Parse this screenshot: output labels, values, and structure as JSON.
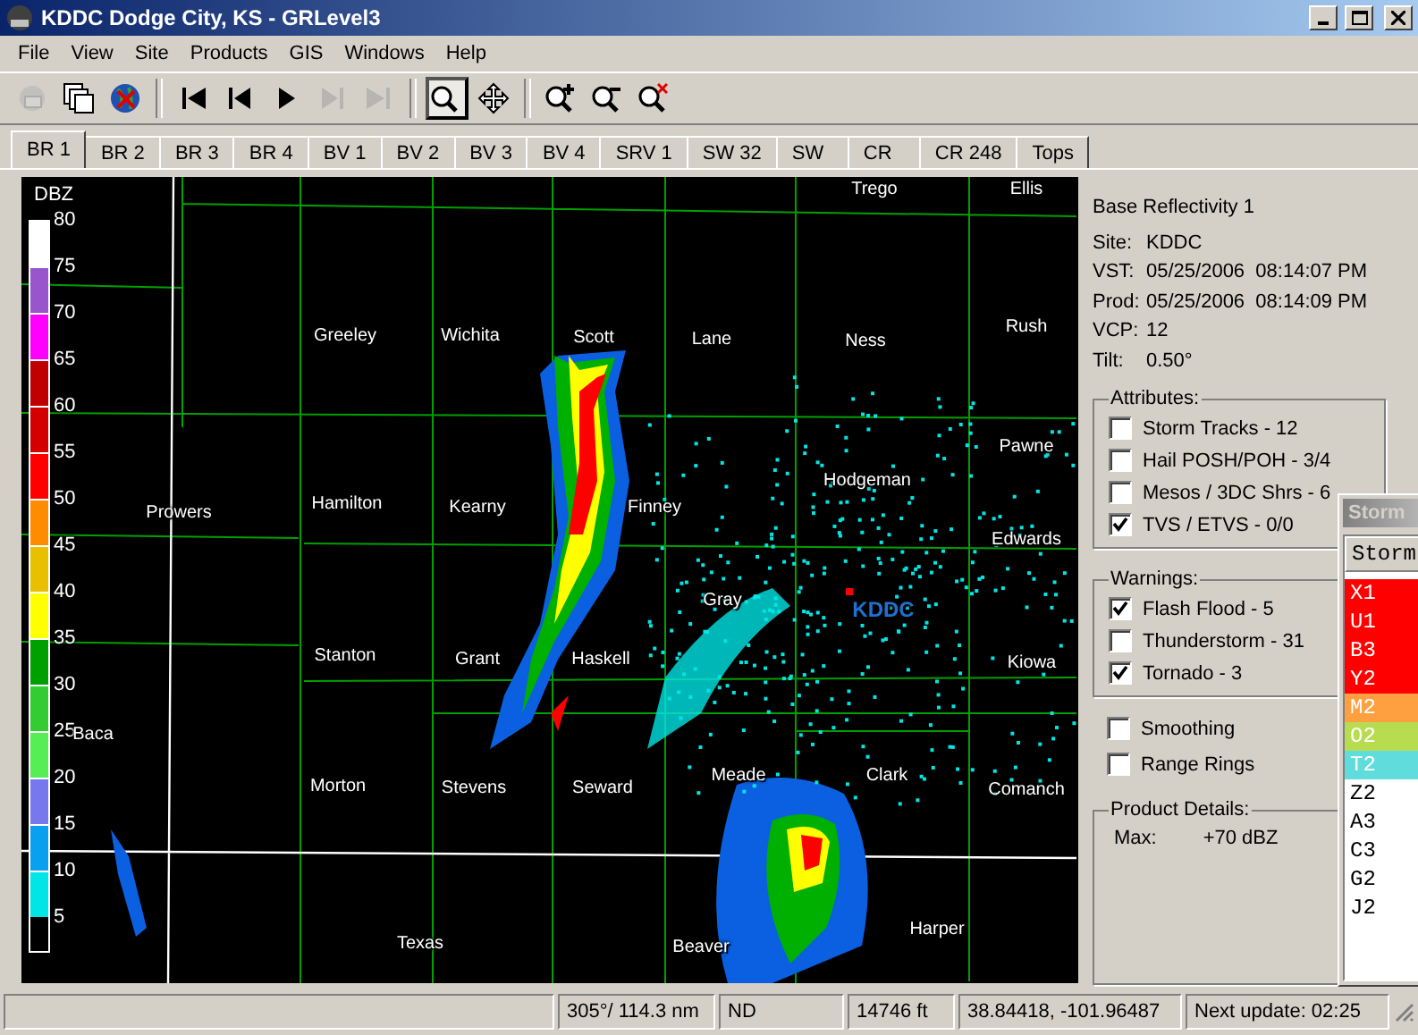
{
  "window": {
    "title": "KDDC Dodge City, KS - GRLevel3"
  },
  "menu": [
    "File",
    "View",
    "Site",
    "Products",
    "GIS",
    "Windows",
    "Help"
  ],
  "toolbar": [
    {
      "kind": "save",
      "disabled": true,
      "selected": false
    },
    {
      "kind": "copy",
      "disabled": false,
      "selected": false
    },
    {
      "kind": "globe",
      "disabled": false,
      "selected": false
    },
    {
      "kind": "separator"
    },
    {
      "kind": "first",
      "disabled": false,
      "selected": false
    },
    {
      "kind": "prev",
      "disabled": false,
      "selected": false
    },
    {
      "kind": "play",
      "disabled": false,
      "selected": false
    },
    {
      "kind": "next",
      "disabled": true,
      "selected": false
    },
    {
      "kind": "last",
      "disabled": true,
      "selected": false
    },
    {
      "kind": "separator"
    },
    {
      "kind": "zoom",
      "disabled": false,
      "selected": true
    },
    {
      "kind": "pan",
      "disabled": false,
      "selected": false
    },
    {
      "kind": "separator"
    },
    {
      "kind": "zoom-in",
      "disabled": false,
      "selected": false
    },
    {
      "kind": "zoom-out",
      "disabled": false,
      "selected": false
    },
    {
      "kind": "zoom-reset",
      "disabled": false,
      "selected": false
    }
  ],
  "tabs": [
    {
      "label": "BR 1",
      "selected": true
    },
    {
      "label": "BR 2",
      "selected": false
    },
    {
      "label": "BR 3",
      "selected": false
    },
    {
      "label": "BR 4",
      "selected": false
    },
    {
      "label": "BV 1",
      "selected": false
    },
    {
      "label": "BV 2",
      "selected": false
    },
    {
      "label": "BV 3",
      "selected": false
    },
    {
      "label": "BV 4",
      "selected": false
    },
    {
      "label": "SRV 1",
      "selected": false
    },
    {
      "label": "SW 32",
      "selected": false
    },
    {
      "label": "SW",
      "selected": false
    },
    {
      "label": "CR",
      "selected": false
    },
    {
      "label": "CR 248",
      "selected": false
    },
    {
      "label": "Tops",
      "selected": false
    }
  ],
  "legend": {
    "title": "DBZ",
    "ticks": [
      "80",
      "75",
      "70",
      "65",
      "60",
      "55",
      "50",
      "45",
      "40",
      "35",
      "30",
      "25",
      "20",
      "15",
      "10",
      "5"
    ],
    "bands": [
      {
        "color": "#ffffff"
      },
      {
        "color": "#9955cc"
      },
      {
        "color": "#ff00ff"
      },
      {
        "color": "#c00000"
      },
      {
        "color": "#d40000"
      },
      {
        "color": "#ff0000"
      },
      {
        "color": "#ff8c00"
      },
      {
        "color": "#e8c000"
      },
      {
        "color": "#ffff00"
      },
      {
        "color": "#00a000"
      },
      {
        "color": "#33cc33"
      },
      {
        "color": "#55ee55"
      },
      {
        "color": "#7777ee"
      },
      {
        "color": "#0aa0f0"
      },
      {
        "color": "#00e5e5"
      }
    ]
  },
  "map_labels": [
    {
      "text": "Trego",
      "kind": "county"
    },
    {
      "text": "Ellis",
      "kind": "county"
    },
    {
      "text": "Greeley",
      "kind": "county"
    },
    {
      "text": "Wichita",
      "kind": "county"
    },
    {
      "text": "Scott",
      "kind": "county"
    },
    {
      "text": "Lane",
      "kind": "county"
    },
    {
      "text": "Ness",
      "kind": "county"
    },
    {
      "text": "Rush",
      "kind": "county"
    },
    {
      "text": "Pawne",
      "kind": "county"
    },
    {
      "text": "Prowers",
      "kind": "county"
    },
    {
      "text": "Hamilton",
      "kind": "county"
    },
    {
      "text": "Kearny",
      "kind": "county"
    },
    {
      "text": "Finney",
      "kind": "county"
    },
    {
      "text": "Hodgeman",
      "kind": "county"
    },
    {
      "text": "Edwards",
      "kind": "county"
    },
    {
      "text": "Gray",
      "kind": "county"
    },
    {
      "text": "KDDC",
      "kind": "site"
    },
    {
      "text": "Stanton",
      "kind": "county"
    },
    {
      "text": "Grant",
      "kind": "county"
    },
    {
      "text": "Haskell",
      "kind": "county"
    },
    {
      "text": "Kiowa",
      "kind": "county"
    },
    {
      "text": "Baca",
      "kind": "county"
    },
    {
      "text": "Morton",
      "kind": "county"
    },
    {
      "text": "Stevens",
      "kind": "county"
    },
    {
      "text": "Seward",
      "kind": "county"
    },
    {
      "text": "Meade",
      "kind": "county"
    },
    {
      "text": "Clark",
      "kind": "county"
    },
    {
      "text": "Comanch",
      "kind": "county"
    },
    {
      "text": "Texas",
      "kind": "county"
    },
    {
      "text": "Beaver",
      "kind": "county"
    },
    {
      "text": "Harper",
      "kind": "county"
    }
  ],
  "info": {
    "product": "Base Reflectivity 1",
    "rows": [
      {
        "label": "Site:",
        "value": "KDDC"
      },
      {
        "label": "VST:",
        "value": "05/25/2006  08:14:07 PM"
      },
      {
        "label": "Prod:",
        "value": "05/25/2006  08:14:09 PM"
      },
      {
        "label": "VCP:",
        "value": "12"
      },
      {
        "label": "Tilt:",
        "value": "0.50°"
      }
    ]
  },
  "attributes": {
    "title": "Attributes:",
    "items": [
      {
        "label": "Storm Tracks - 12",
        "checked": false
      },
      {
        "label": "Hail POSH/POH - 3/4",
        "checked": false
      },
      {
        "label": "Mesos / 3DC Shrs - 6",
        "checked": false
      },
      {
        "label": "TVS / ETVS - 0/0",
        "checked": true
      }
    ]
  },
  "warnings": {
    "title": "Warnings:",
    "items": [
      {
        "label": "Flash Flood - 5",
        "checked": true
      },
      {
        "label": "Thunderstorm - 31",
        "checked": false
      },
      {
        "label": "Tornado - 3",
        "checked": true
      }
    ]
  },
  "options": [
    {
      "label": "Smoothing",
      "checked": false
    },
    {
      "label": "Range Rings",
      "checked": false
    }
  ],
  "product_details": {
    "title": "Product Details:",
    "label": "Max:",
    "value": "+70 dBZ"
  },
  "storm_window": {
    "title": "Storm",
    "column": "Storm",
    "rows": [
      {
        "id": "X1",
        "color": "#ff0000"
      },
      {
        "id": "U1",
        "color": "#ff0000"
      },
      {
        "id": "B3",
        "color": "#ff0000"
      },
      {
        "id": "Y2",
        "color": "#ff0000"
      },
      {
        "id": "M2",
        "color": "#ffa040"
      },
      {
        "id": "O2",
        "color": "#b8dc50"
      },
      {
        "id": "T2",
        "color": "#60dcdc"
      },
      {
        "id": "Z2",
        "color": "#ffffff"
      },
      {
        "id": "A3",
        "color": "#ffffff"
      },
      {
        "id": "C3",
        "color": "#ffffff"
      },
      {
        "id": "G2",
        "color": "#ffffff"
      },
      {
        "id": "J2",
        "color": "#ffffff"
      }
    ]
  },
  "status_bar": [
    "305°/ 114.3 nm",
    "ND",
    "14746 ft",
    "38.84418, -101.96487",
    "Next update: 02:25"
  ]
}
